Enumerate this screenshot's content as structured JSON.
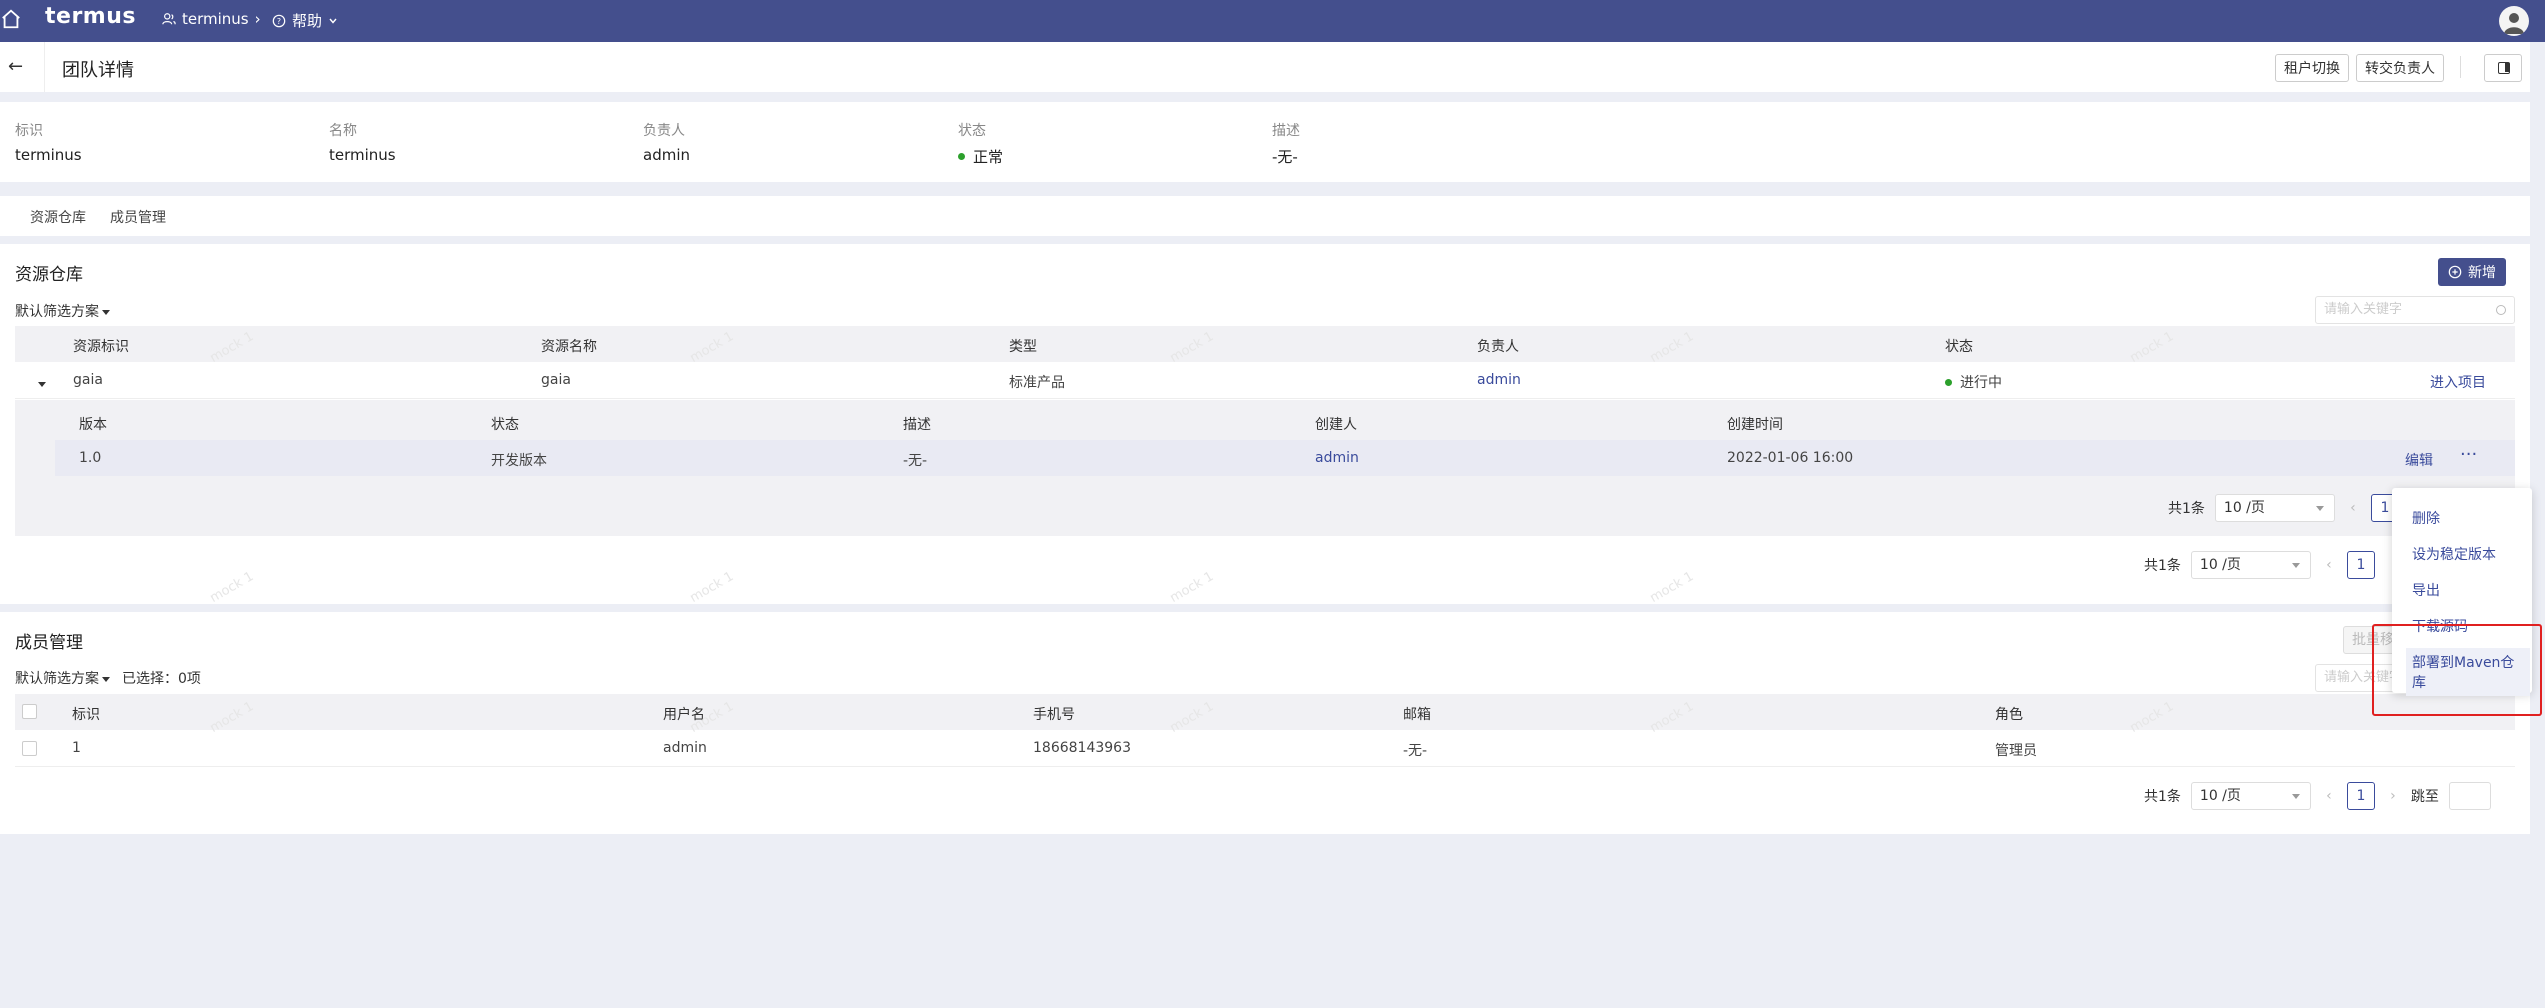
{
  "topbar": {
    "logo": "termus",
    "org": "terminus",
    "help": "帮助"
  },
  "header": {
    "title": "团队详情",
    "switch_tenant": "租户切换",
    "transfer_owner": "转交负责人"
  },
  "info": [
    {
      "label": "标识",
      "value": "terminus"
    },
    {
      "label": "名称",
      "value": "terminus"
    },
    {
      "label": "负责人",
      "value": "admin"
    },
    {
      "label": "状态",
      "value": "正常"
    },
    {
      "label": "描述",
      "value": "-无-"
    }
  ],
  "tabs": [
    "资源仓库",
    "成员管理"
  ],
  "repo": {
    "title": "资源仓库",
    "add": "新增",
    "filter": "默认筛选方案",
    "search_placeholder": "请输入关键字",
    "columns": [
      "资源标识",
      "资源名称",
      "类型",
      "负责人",
      "状态"
    ],
    "row": {
      "id": "gaia",
      "name": "gaia",
      "type": "标准产品",
      "owner": "admin",
      "status": "进行中",
      "action": "进入项目"
    },
    "sub_columns": [
      "版本",
      "状态",
      "描述",
      "创建人",
      "创建时间"
    ],
    "sub_row": {
      "version": "1.0",
      "status": "开发版本",
      "desc": "-无-",
      "creator": "admin",
      "created": "2022-01-06 16:00",
      "edit": "编辑",
      "more": "···"
    },
    "sub_pager": {
      "total": "共1条",
      "size": "10 /页",
      "page": "1"
    },
    "pager": {
      "total": "共1条",
      "size": "10 /页",
      "page": "1"
    }
  },
  "members": {
    "title": "成员管理",
    "batch": "批量移除",
    "filter": "默认筛选方案",
    "selected": "已选择：0项",
    "search_placeholder": "请输入关键字",
    "columns": [
      "标识",
      "用户名",
      "手机号",
      "邮箱",
      "角色"
    ],
    "row": {
      "id": "1",
      "username": "admin",
      "phone": "18668143963",
      "email": "-无-",
      "role": "管理员"
    },
    "pager": {
      "total": "共1条",
      "size": "10 /页",
      "page": "1",
      "jump": "跳至"
    }
  },
  "menu": [
    "删除",
    "设为稳定版本",
    "导出",
    "下载源码",
    "部署到Maven仓库"
  ],
  "watermark": "mock 1",
  "colors": {
    "topbar": "#444f8d",
    "primary": "#3a4b9c",
    "highlight": "#e02020"
  }
}
